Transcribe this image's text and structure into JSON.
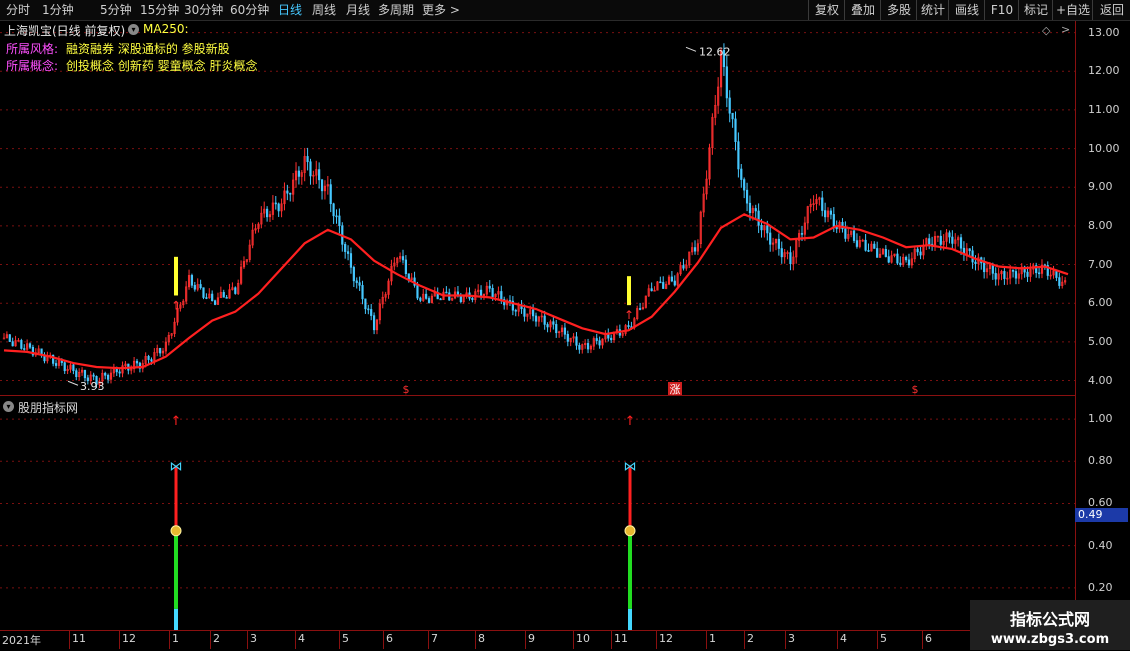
{
  "toolbar": {
    "tabs": [
      "分时",
      "1分钟",
      "5分钟",
      "15分钟",
      "30分钟",
      "60分钟",
      "日线",
      "周线",
      "月线",
      "多周期",
      "更多 >"
    ],
    "active_tab": "日线",
    "right_buttons": [
      "复权",
      "叠加",
      "多股",
      "统计",
      "画线",
      "F10",
      "标记",
      "+自选",
      "返回"
    ]
  },
  "main_chart": {
    "stock_title": "上海凯宝(日线 前复权)",
    "ma_label": "MA250:",
    "style_label": "所属风格:",
    "style_value": "融资融券 深股通标的 参股新股",
    "concept_label": "所属概念:",
    "concept_value": "创投概念 创新药 婴童概念 肝炎概念",
    "high_label": "12.62",
    "low_label": "3.93",
    "event_markers": [
      "$",
      "涨",
      "$"
    ]
  },
  "sub_chart": {
    "title": "股朋指标网",
    "current_value": "0.49"
  },
  "chart_data": [
    {
      "type": "line",
      "title": "上海凯宝(日线 前复权)",
      "price_axis_ticks": [
        "13.00",
        "12.00",
        "11.00",
        "10.00",
        "9.00",
        "8.00",
        "7.00",
        "6.00",
        "5.00",
        "4.00"
      ],
      "ylim": [
        3.6,
        13.3
      ],
      "time_axis_labels": [
        "2021年",
        "11",
        "12",
        "1",
        "2",
        "3",
        "4",
        "5",
        "6",
        "7",
        "8",
        "9",
        "10",
        "11",
        "12",
        "1",
        "2",
        "3",
        "4",
        "5",
        "6"
      ],
      "series": [
        {
          "name": "MA250",
          "color": "#ff2020",
          "values": [
            4.78,
            4.74,
            4.62,
            4.45,
            4.35,
            4.32,
            4.35,
            4.62,
            5.1,
            5.55,
            5.78,
            6.25,
            6.9,
            7.55,
            7.9,
            7.65,
            7.1,
            6.75,
            6.45,
            6.2,
            6.2,
            6.15,
            6.0,
            5.85,
            5.6,
            5.35,
            5.2,
            5.3,
            5.65,
            6.3,
            7.05,
            7.95,
            8.3,
            8.05,
            7.65,
            7.7,
            8.0,
            7.9,
            7.7,
            7.45,
            7.5,
            7.4,
            7.15,
            6.95,
            6.9,
            6.95,
            6.75
          ]
        },
        {
          "name": "close",
          "color": "#46c8ff",
          "values": [
            5.1,
            4.85,
            4.55,
            4.25,
            4.0,
            4.3,
            4.45,
            4.9,
            6.6,
            6.05,
            6.35,
            8.2,
            8.6,
            9.65,
            8.9,
            6.9,
            5.4,
            7.3,
            6.1,
            6.2,
            6.15,
            6.35,
            5.9,
            5.65,
            5.3,
            4.85,
            5.1,
            5.35,
            6.4,
            6.6,
            7.6,
            12.4,
            8.75,
            7.75,
            7.1,
            8.75,
            8.0,
            7.55,
            7.25,
            7.05,
            7.6,
            7.7,
            7.1,
            6.7,
            6.8,
            6.9,
            6.4
          ]
        }
      ],
      "annotations": [
        {
          "text": "12.62",
          "value": 12.62
        },
        {
          "text": "3.93",
          "value": 3.93
        }
      ]
    },
    {
      "type": "bar",
      "title": "股朋指标网",
      "y_axis_ticks": [
        "1.00",
        "0.80",
        "0.60",
        "0.40",
        "0.20"
      ],
      "ylim": [
        0,
        1.1
      ],
      "signals": [
        {
          "label": "1",
          "base_bottom": 0.0,
          "base_top": 0.48,
          "top": 0.78,
          "arrow": 1.0
        },
        {
          "label": "11",
          "base_bottom": 0.0,
          "base_top": 0.48,
          "top": 0.78,
          "arrow": 1.0
        }
      ],
      "current_value": 0.49
    }
  ],
  "watermark": {
    "line1": "指标公式网",
    "line2": "www.zbgs3.com"
  },
  "colors": {
    "background": "#000000",
    "ma_line": "#ff2020",
    "up_candle": "#ff3030",
    "down_candle": "#46c8ff",
    "grid": "#7a1010",
    "active_tab": "#46c8ff",
    "highlight_value_bg": "#1c3aa8"
  }
}
